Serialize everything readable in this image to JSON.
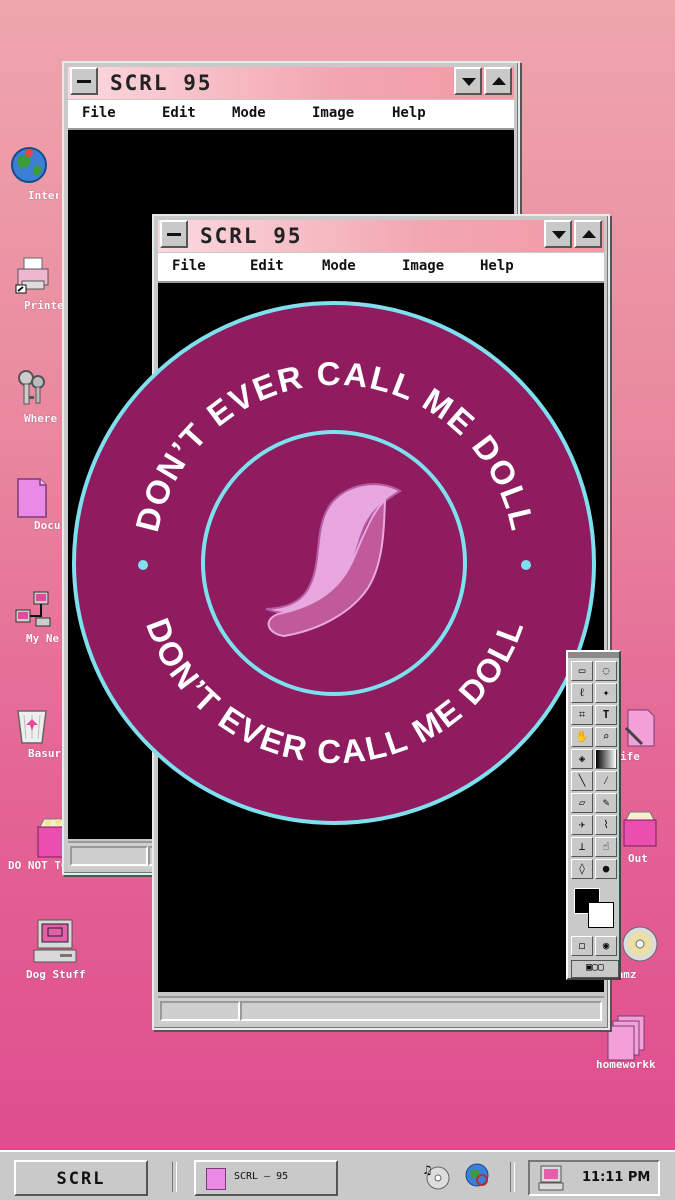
{
  "desktop": {
    "left_icons": [
      {
        "label": "Inter",
        "icon": "globe-icon"
      },
      {
        "label": "Printe",
        "icon": "printer-icon"
      },
      {
        "label": "Where",
        "icon": "keys-icon"
      },
      {
        "label": "Docu",
        "icon": "folder-icon"
      },
      {
        "label": "My Ne",
        "icon": "network-icon"
      },
      {
        "label": "Basur",
        "icon": "recycle-bin-icon"
      },
      {
        "label": "DO NOT TOUCH",
        "icon": "food-box-icon"
      },
      {
        "label": "Dog Stuff",
        "icon": "computer-icon"
      }
    ],
    "right_icons": [
      {
        "label": "ife",
        "icon": "document-icon"
      },
      {
        "label": "Out",
        "icon": "food-box-icon"
      },
      {
        "label": "Jamz",
        "icon": "cd-icon"
      },
      {
        "label": "homeworkk",
        "icon": "papers-icon"
      }
    ]
  },
  "back_window": {
    "title": "SCRL 95",
    "menu": [
      "File",
      "Edit",
      "Mode",
      "Image",
      "Help"
    ]
  },
  "front_window": {
    "title": "SCRL 95",
    "menu": [
      "File",
      "Edit",
      "Mode",
      "Image",
      "Help"
    ]
  },
  "badge": {
    "text_top": "DON’T EVER CALL ME DOLL",
    "text_bottom": "DON’T EVER CALL ME DOLL",
    "fill": "#8e1c5f",
    "ring": "#7ee0ee",
    "logo": "feather-swoosh-icon"
  },
  "taskbar": {
    "start_label": "SCRL",
    "task_label": "SCRL – 95",
    "clock": "11:11 PM",
    "tray_icons": [
      "music-cd-icon",
      "globe-magnifier-icon",
      "computer-icon"
    ]
  },
  "colors": {
    "accent": "#e44f93",
    "title_gradient_end": "#f39aa6"
  }
}
